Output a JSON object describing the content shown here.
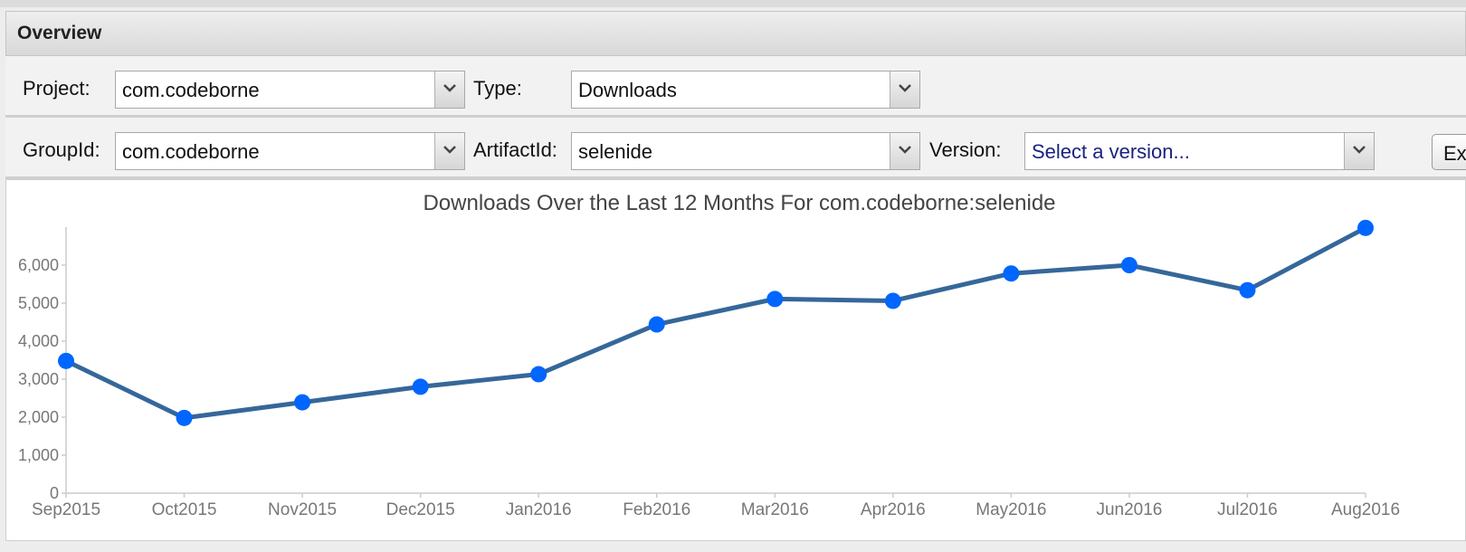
{
  "panel": {
    "title": "Overview"
  },
  "filters": {
    "project_label": "Project:",
    "project_value": "com.codeborne",
    "type_label": "Type:",
    "type_value": "Downloads",
    "groupid_label": "GroupId:",
    "groupid_value": "com.codeborne",
    "artifactid_label": "ArtifactId:",
    "artifactid_value": "selenide",
    "version_label": "Version:",
    "version_placeholder": "Select a version...",
    "export_button": "Exp"
  },
  "colors": {
    "line": "#35679a",
    "point": "#0066ff",
    "axis": "#cccccc"
  },
  "chart_data": {
    "type": "line",
    "title": "Downloads Over the Last 12 Months For com.codeborne:selenide",
    "xlabel": "",
    "ylabel": "",
    "categories": [
      "Sep2015",
      "Oct2015",
      "Nov2015",
      "Dec2015",
      "Jan2016",
      "Feb2016",
      "Mar2016",
      "Apr2016",
      "May2016",
      "Jun2016",
      "Jul2016",
      "Aug2016"
    ],
    "y_ticks": [
      "0",
      "1,000",
      "2,000",
      "3,000",
      "4,000",
      "5,000",
      "6,000"
    ],
    "ylim": [
      0,
      7000
    ],
    "grid": false,
    "series": [
      {
        "values": [
          3480,
          1980,
          2390,
          2800,
          3130,
          4440,
          5110,
          5060,
          5780,
          6000,
          5340,
          6980
        ]
      }
    ]
  }
}
